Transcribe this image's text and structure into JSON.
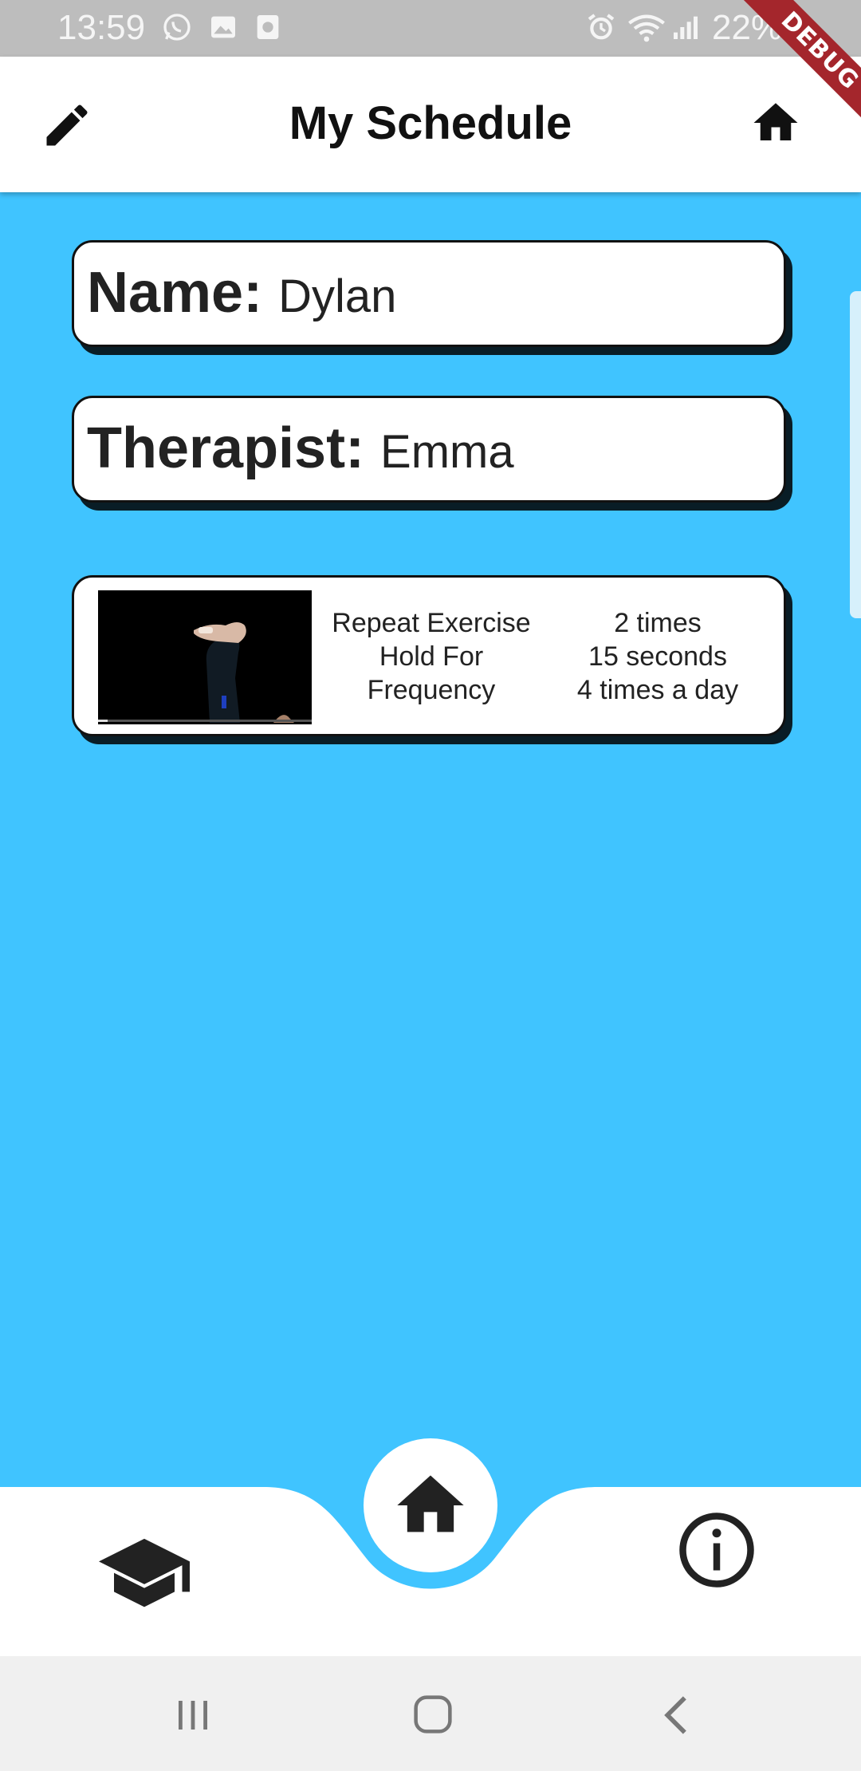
{
  "status_bar": {
    "time": "13:59",
    "battery": "22%",
    "icons": [
      "whatsapp-icon",
      "image-icon",
      "screenshot-icon",
      "alarm-icon",
      "wifi-icon",
      "signal-icon"
    ]
  },
  "debug_banner": "DEBUG",
  "app_bar": {
    "title": "My Schedule",
    "left_icon": "edit-icon",
    "right_icon": "home-icon"
  },
  "profile": {
    "name_label": "Name:",
    "name_value": "Dylan",
    "therapist_label": "Therapist:",
    "therapist_value": "Emma"
  },
  "exercises": [
    {
      "labels": [
        "Repeat Exercise",
        "Hold For",
        "Frequency"
      ],
      "values": [
        "2 times",
        "15 seconds",
        "4 times a day"
      ]
    }
  ],
  "bottom_nav": {
    "items": [
      "graduation-cap-icon",
      "home-icon",
      "info-icon"
    ],
    "active": "home-icon"
  },
  "system_nav": [
    "recent-apps-icon",
    "home-circle-icon",
    "back-icon"
  ],
  "colors": {
    "background": "#40c4ff",
    "surface": "#ffffff",
    "debug_ribbon": "#a4262c"
  }
}
